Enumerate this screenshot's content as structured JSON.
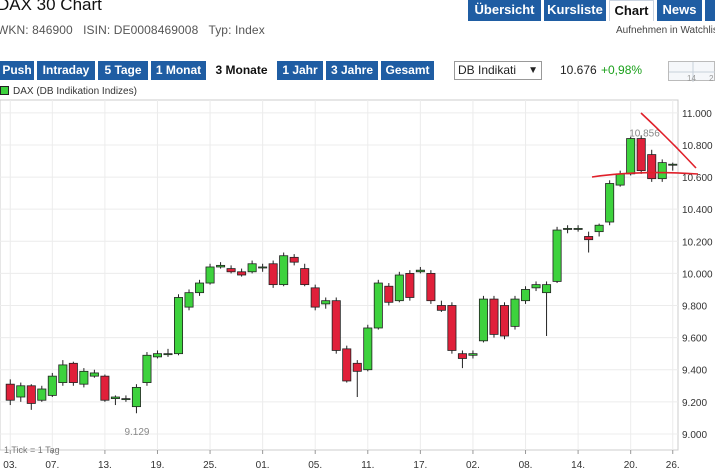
{
  "header": {
    "title": "DAX 30 Chart"
  },
  "tabs": [
    {
      "label": "Übersicht",
      "active": false
    },
    {
      "label": "Kursliste",
      "active": false
    },
    {
      "label": "Chart",
      "active": true
    },
    {
      "label": "News",
      "active": false
    }
  ],
  "meta": {
    "wkn": "WKN: 846900",
    "isin": "ISIN: DE0008469008",
    "type": "Typ: Index"
  },
  "watchlist_link": "Aufnehmen in Watchlis",
  "periods": [
    {
      "label": "Push",
      "active": false
    },
    {
      "label": "Intraday",
      "active": false
    },
    {
      "label": "5 Tage",
      "active": false
    },
    {
      "label": "1 Monat",
      "active": false
    },
    {
      "label": "3 Monate",
      "active": true
    },
    {
      "label": "1 Jahr",
      "active": false
    },
    {
      "label": "3 Jahre",
      "active": false
    },
    {
      "label": "Gesamt",
      "active": false
    }
  ],
  "exchange": {
    "selected": "DB Indikati"
  },
  "quote": {
    "value": "10.676",
    "change": "+0,98%"
  },
  "mini_chart_labels": [
    "14",
    "2"
  ],
  "legend": "DAX (DB Indikation Indizes)",
  "tick_info": "1 Tick = 1 Tag",
  "colors": {
    "up": "#3dd23d",
    "down": "#e0203a",
    "nav": "#1f5da3",
    "annotation": "#e0202a"
  },
  "chart_data": {
    "type": "candlestick",
    "y_ticks": [
      "11.000",
      "10.800",
      "10.600",
      "10.400",
      "10.200",
      "10.000",
      "9.800",
      "9.600",
      "9.400",
      "9.200",
      "9.000"
    ],
    "x_ticks": [
      "03.",
      "07.",
      "13.",
      "19.",
      "25.",
      "01.",
      "05.",
      "11.",
      "17.",
      "02.",
      "08.",
      "14.",
      "20.",
      "26."
    ],
    "ylim": [
      8900,
      11080
    ],
    "annotations": {
      "high_label": "10.856",
      "low_label": "9.129"
    },
    "candles": [
      [
        9310,
        9210,
        9340,
        9180
      ],
      [
        9230,
        9300,
        9320,
        9200
      ],
      [
        9300,
        9190,
        9310,
        9150
      ],
      [
        9210,
        9280,
        9300,
        9200
      ],
      [
        9240,
        9360,
        9380,
        9230
      ],
      [
        9320,
        9430,
        9460,
        9300
      ],
      [
        9440,
        9320,
        9450,
        9300
      ],
      [
        9310,
        9390,
        9410,
        9290
      ],
      [
        9360,
        9380,
        9400,
        9350
      ],
      [
        9360,
        9210,
        9370,
        9200
      ],
      [
        9220,
        9230,
        9240,
        9180
      ],
      [
        9220,
        9220,
        9240,
        9200
      ],
      [
        9170,
        9290,
        9310,
        9129
      ],
      [
        9320,
        9490,
        9510,
        9300
      ],
      [
        9480,
        9500,
        9520,
        9470
      ],
      [
        9500,
        9500,
        9530,
        9480
      ],
      [
        9500,
        9850,
        9870,
        9490
      ],
      [
        9790,
        9880,
        9900,
        9770
      ],
      [
        9880,
        9940,
        9960,
        9860
      ],
      [
        9940,
        10040,
        10060,
        9930
      ],
      [
        10040,
        10050,
        10070,
        10030
      ],
      [
        10030,
        10010,
        10050,
        10000
      ],
      [
        10010,
        9990,
        10030,
        9980
      ],
      [
        10010,
        10060,
        10080,
        10000
      ],
      [
        10040,
        10040,
        10060,
        10010
      ],
      [
        10060,
        9930,
        10080,
        9910
      ],
      [
        9930,
        10110,
        10130,
        9920
      ],
      [
        10100,
        10070,
        10120,
        10050
      ],
      [
        10030,
        9930,
        10060,
        9920
      ],
      [
        9910,
        9790,
        9930,
        9770
      ],
      [
        9810,
        9830,
        9850,
        9780
      ],
      [
        9830,
        9520,
        9850,
        9500
      ],
      [
        9530,
        9330,
        9550,
        9320
      ],
      [
        9440,
        9390,
        9460,
        9230
      ],
      [
        9400,
        9660,
        9680,
        9390
      ],
      [
        9660,
        9940,
        9960,
        9650
      ],
      [
        9920,
        9820,
        9940,
        9800
      ],
      [
        9830,
        9990,
        10010,
        9820
      ],
      [
        10000,
        9850,
        10020,
        9830
      ],
      [
        10010,
        10020,
        10040,
        10000
      ],
      [
        10000,
        9830,
        10020,
        9810
      ],
      [
        9800,
        9770,
        9830,
        9760
      ],
      [
        9800,
        9520,
        9820,
        9500
      ],
      [
        9500,
        9470,
        9520,
        9410
      ],
      [
        9490,
        9500,
        9520,
        9470
      ],
      [
        9580,
        9840,
        9860,
        9570
      ],
      [
        9840,
        9620,
        9860,
        9600
      ],
      [
        9800,
        9610,
        9820,
        9590
      ],
      [
        9670,
        9840,
        9860,
        9650
      ],
      [
        9830,
        9900,
        9920,
        9810
      ],
      [
        9910,
        9930,
        9950,
        9890
      ],
      [
        9880,
        9930,
        9950,
        9610
      ],
      [
        9950,
        10270,
        10290,
        9940
      ],
      [
        10280,
        10280,
        10300,
        10250
      ],
      [
        10280,
        10280,
        10300,
        10260
      ],
      [
        10230,
        10210,
        10260,
        10130
      ],
      [
        10260,
        10300,
        10310,
        10230
      ],
      [
        10320,
        10560,
        10580,
        10300
      ],
      [
        10550,
        10620,
        10640,
        10540
      ],
      [
        10620,
        10840,
        10850,
        10610
      ],
      [
        10840,
        10640,
        10860,
        10620
      ],
      [
        10740,
        10590,
        10770,
        10570
      ],
      [
        10590,
        10690,
        10710,
        10570
      ],
      [
        10680,
        10680,
        10690,
        10640
      ]
    ]
  }
}
